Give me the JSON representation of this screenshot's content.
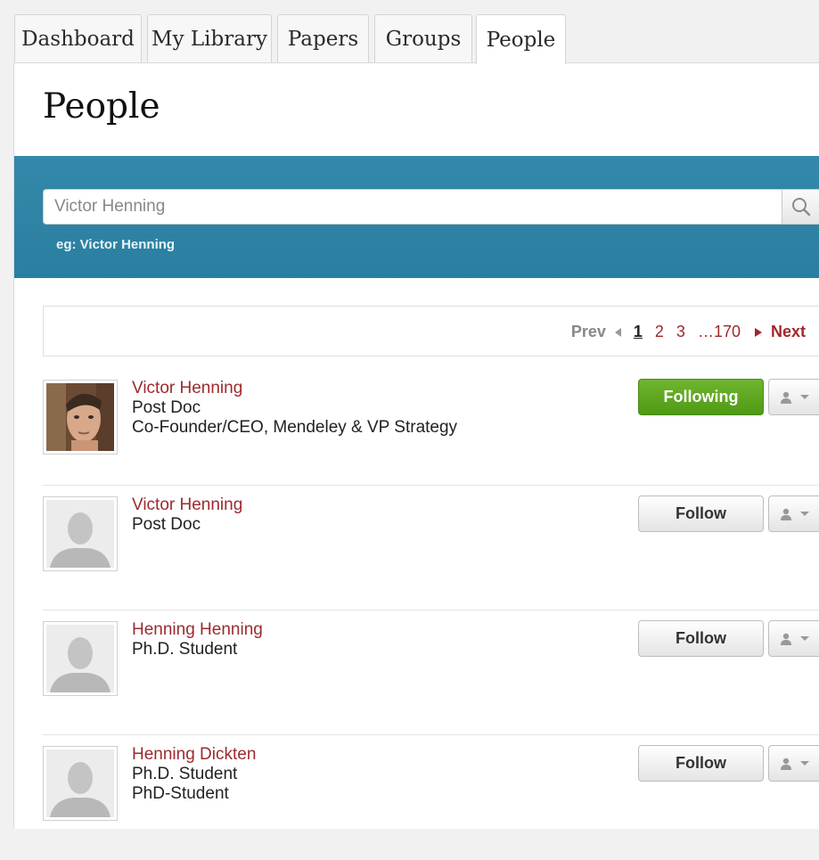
{
  "tabs": [
    {
      "label": "Dashboard"
    },
    {
      "label": "My Library"
    },
    {
      "label": "Papers"
    },
    {
      "label": "Groups"
    },
    {
      "label": "People",
      "active": true
    }
  ],
  "page": {
    "title": "People"
  },
  "search": {
    "placeholder": "Victor Henning",
    "hint": "eg: Victor Henning",
    "icon": "search-icon"
  },
  "pagination": {
    "prev_label": "Prev",
    "pages": [
      "1",
      "2",
      "3"
    ],
    "current_page": "1",
    "ellipsis": "…",
    "last_page": "170",
    "next_label": "Next"
  },
  "people": [
    {
      "name": "Victor Henning",
      "line1": "Post Doc",
      "line2": "Co-Founder/CEO, Mendeley & VP Strategy",
      "button": "Following",
      "avatar": "photo"
    },
    {
      "name": "Victor Henning",
      "line1": "Post Doc",
      "line2": "",
      "button": "Follow",
      "avatar": "default-avatar-icon"
    },
    {
      "name": "Henning Henning",
      "line1": "Ph.D. Student",
      "line2": "",
      "button": "Follow",
      "avatar": "default-avatar-icon"
    },
    {
      "name": "Henning Dickten",
      "line1": "Ph.D. Student",
      "line2": "PhD-Student",
      "button": "Follow",
      "avatar": "default-avatar-icon"
    }
  ],
  "colors": {
    "accent_blue": "#2f85a6",
    "link_red": "#9c2a2e",
    "following_green": "#5aa51e"
  }
}
